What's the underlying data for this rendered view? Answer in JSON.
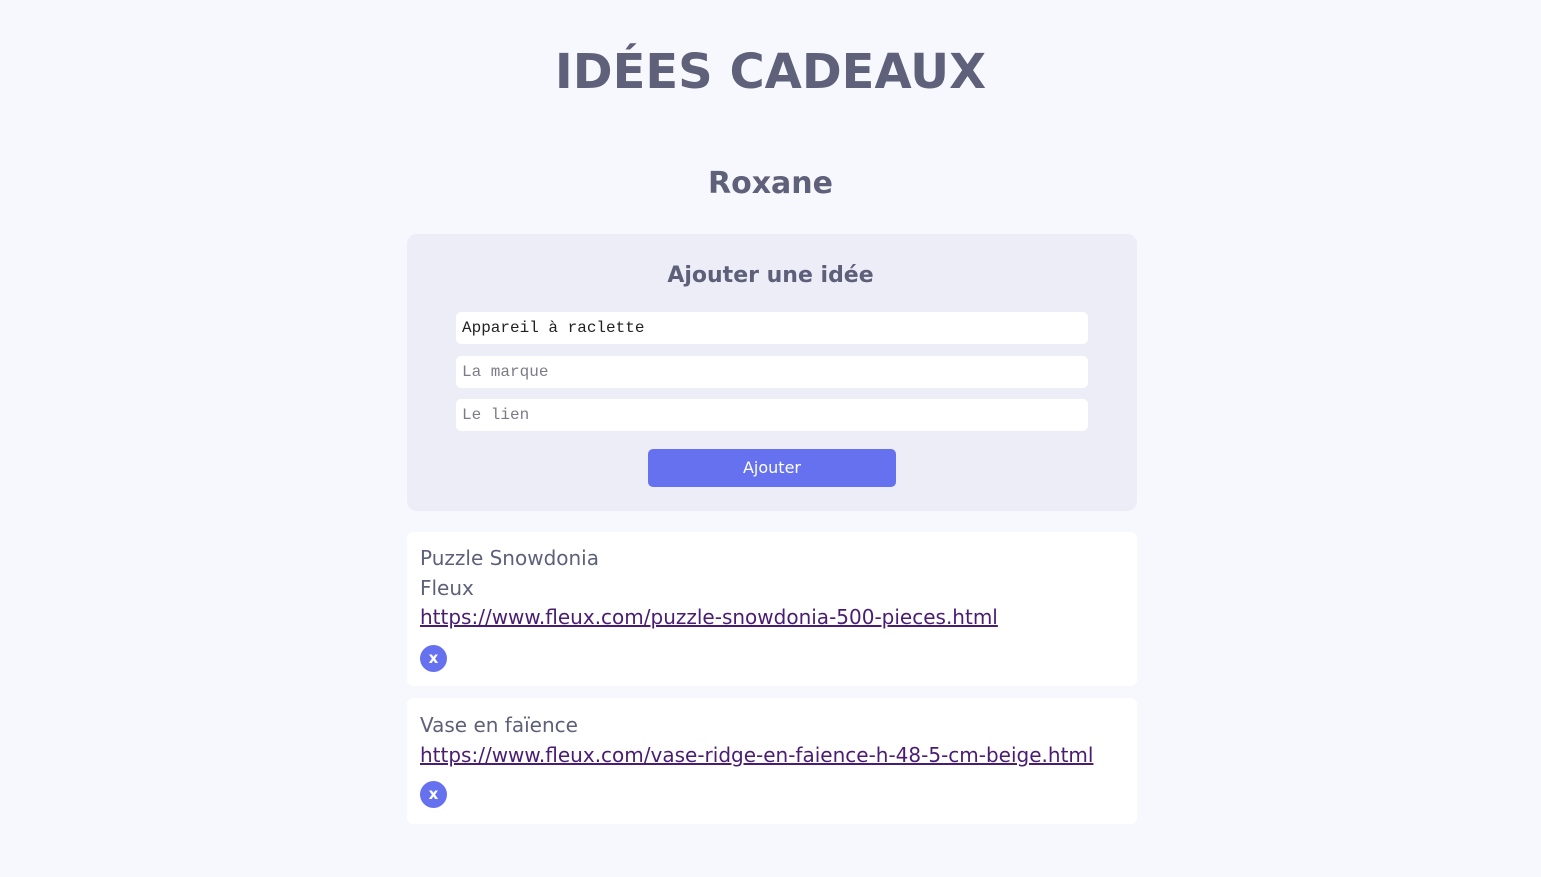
{
  "header": {
    "title": "IDÉES CADEAUX"
  },
  "person": {
    "name": "Roxane"
  },
  "add_form": {
    "title": "Ajouter une idée",
    "name_input": {
      "value": "Appareil à raclette",
      "placeholder": ""
    },
    "brand_input": {
      "value": "",
      "placeholder": "La marque"
    },
    "link_input": {
      "value": "",
      "placeholder": "Le lien"
    },
    "submit_label": "Ajouter"
  },
  "ideas": [
    {
      "name": "Puzzle Snowdonia",
      "brand": "Fleux",
      "link": "https://www.fleux.com/puzzle-snowdonia-500-pieces.html",
      "delete_label": "x"
    },
    {
      "name": "Vase en faïence",
      "brand": "",
      "link": "https://www.fleux.com/vase-ridge-en-faience-h-48-5-cm-beige.html",
      "delete_label": "x"
    }
  ],
  "colors": {
    "background": "#f7f8fd",
    "form_card": "#ecedf7",
    "accent": "#6571ef",
    "text": "#5e607b",
    "link": "#4a1d73"
  }
}
